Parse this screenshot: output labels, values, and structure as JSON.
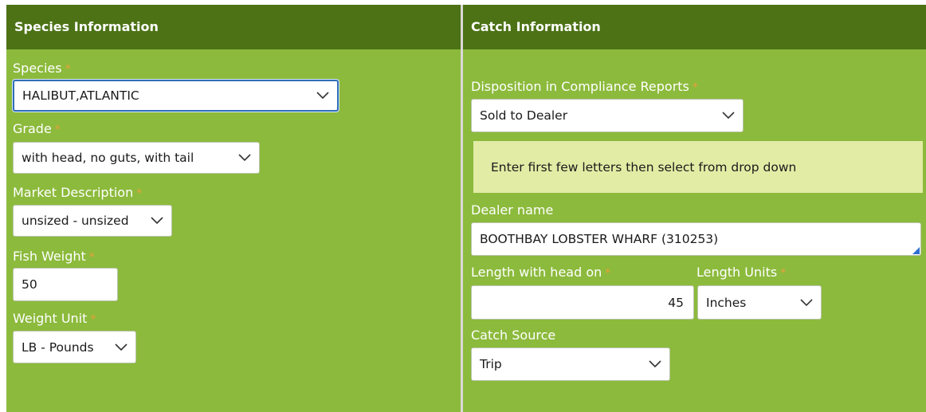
{
  "species_panel": {
    "header": "Species Information",
    "species": {
      "label": "Species",
      "required": "*",
      "value": "HALIBUT,ATLANTIC"
    },
    "grade": {
      "label": "Grade",
      "required": "*",
      "value": "with head, no guts, with tail"
    },
    "market_description": {
      "label": "Market Description",
      "required": "*",
      "value": "unsized - unsized"
    },
    "fish_weight": {
      "label": "Fish Weight",
      "required": "*",
      "value": "50"
    },
    "weight_unit": {
      "label": "Weight Unit",
      "required": "*",
      "value": "LB - Pounds"
    }
  },
  "catch_panel": {
    "header": "Catch Information",
    "disposition": {
      "label": "Disposition in Compliance Reports",
      "required": "*",
      "value": "Sold to Dealer"
    },
    "hint": "Enter first few letters then select from drop down",
    "dealer_name": {
      "label": "Dealer name",
      "value": "BOOTHBAY LOBSTER WHARF (310253)"
    },
    "length_with_head": {
      "label": "Length with head on",
      "required": "*",
      "value": "45"
    },
    "length_units": {
      "label": "Length Units",
      "required": "*",
      "value": "Inches"
    },
    "catch_source": {
      "label": "Catch Source",
      "value": "Trip"
    }
  },
  "colors": {
    "panel_bg": "#8cba3c",
    "header_bg": "#4c7215",
    "required_mark": "#e5a23a",
    "hint_bg": "#e2eca5",
    "focus_border": "#2f6fb8"
  },
  "icons": {
    "dropdown": "chevron-down-icon",
    "resize": "resize-handle-icon"
  }
}
